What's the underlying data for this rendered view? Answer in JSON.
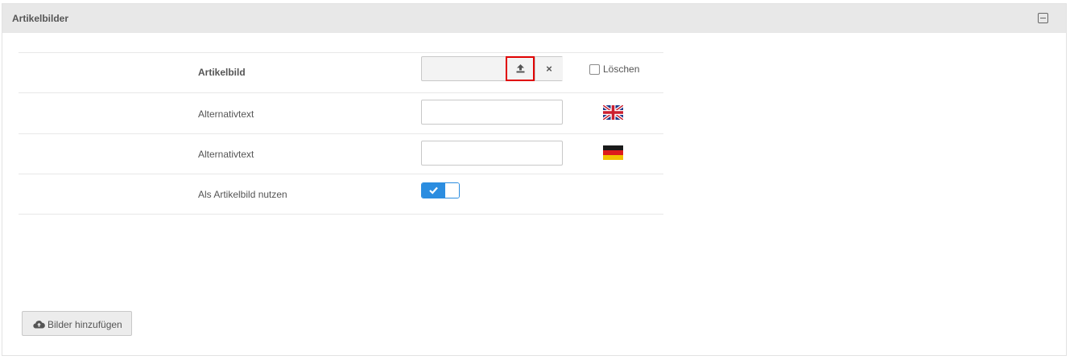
{
  "panel": {
    "title": "Artikelbilder",
    "collapse_icon": "minus-square-icon"
  },
  "rows": {
    "image": {
      "label": "Artikelbild",
      "upload_icon": "upload-icon",
      "remove_label": "×",
      "delete_label": "Löschen",
      "delete_checked": false
    },
    "alt_en": {
      "label": "Alternativtext",
      "value": "",
      "flag_icon": "uk-flag-icon"
    },
    "alt_de": {
      "label": "Alternativtext",
      "value": "",
      "flag_icon": "german-flag-icon"
    },
    "use_as_main": {
      "label": "Als Artikelbild nutzen",
      "enabled": true,
      "icon": "check-icon"
    }
  },
  "footer": {
    "add_button_label": "Bilder hinzufügen",
    "add_button_icon": "cloud-upload-icon"
  },
  "colors": {
    "accent": "#2b8de0",
    "highlight": "#e00000",
    "header_bg": "#e8e8e8"
  }
}
